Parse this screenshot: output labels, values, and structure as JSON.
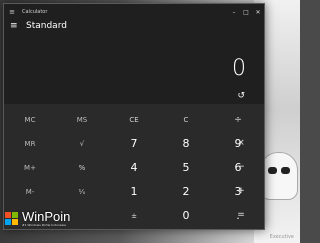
{
  "window": {
    "title": "Calculator",
    "menu_icon": "≡",
    "minimize_icon": "–",
    "maximize_icon": "□",
    "close_icon": "✕"
  },
  "mode": {
    "burger_icon": "≡",
    "label": "Standard"
  },
  "display": {
    "value": "0",
    "history_icon": "↺"
  },
  "memory_keys": [
    "MC",
    "MS",
    "MR",
    "M+",
    "M-"
  ],
  "keys": {
    "ce": "CE",
    "c": "C",
    "backspace": "⌫",
    "divide": "÷",
    "sqrt": "√",
    "percent": "%",
    "reciprocal": "¹⁄ₓ",
    "negate": "±",
    "multiply": "×",
    "minus": "−",
    "plus": "+",
    "equals": "=",
    "decimal": ".",
    "n0": "0",
    "n1": "1",
    "n2": "2",
    "n3": "3",
    "n4": "4",
    "n5": "5",
    "n6": "6",
    "n7": "7",
    "n8": "8",
    "n9": "9"
  },
  "watermark": {
    "brand": "WinPoin",
    "tagline": "#1 Windows Portal Indonesia"
  },
  "corner_text": "Executive"
}
